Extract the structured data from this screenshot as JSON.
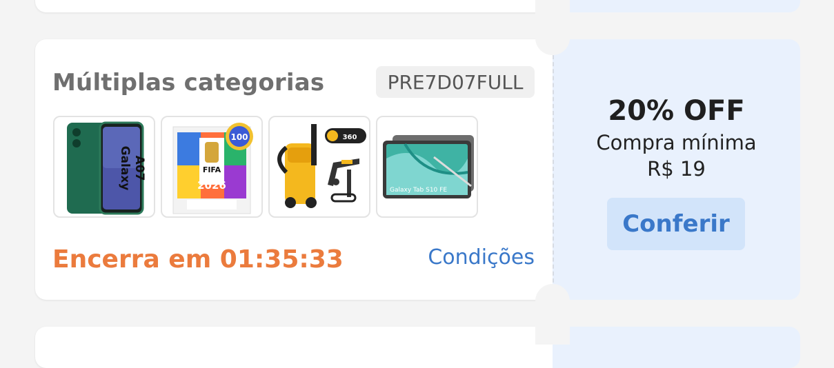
{
  "coupon": {
    "title": "Múltiplas categorias",
    "code": "PRE7D07FULL",
    "timer": "Encerra em 01:35:33",
    "conditions_label": "Condições",
    "discount": "20% OFF",
    "min_purchase_label": "Compra mínima",
    "min_purchase_value": "R$ 19",
    "button_label": "Conferir",
    "products": [
      {
        "name": "phone-galaxy-a07-image",
        "label_line1": "Galaxy",
        "label_line2": "A07"
      },
      {
        "name": "fifa-world-cup-2026-sticker-pack-image",
        "label_line1": "FIFA",
        "label_line2": "2026",
        "badge": "100"
      },
      {
        "name": "pressure-washer-image",
        "badge": "360"
      },
      {
        "name": "tablet-galaxy-tab-s10-fe-image",
        "label": "Galaxy Tab S10 FE"
      }
    ]
  },
  "colors": {
    "timer": "#eb7b3d",
    "link": "#3a78c9",
    "button_bg": "#d2e4fa",
    "right_panel_bg": "#e9f1fd"
  }
}
